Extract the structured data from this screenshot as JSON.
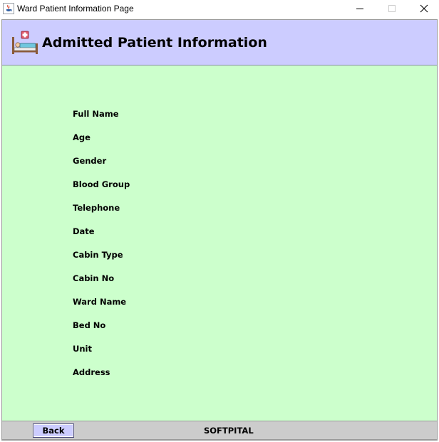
{
  "window": {
    "title": "Ward Patient Information Page",
    "icon": "java-cup-icon",
    "controls": {
      "minimize": "minimize-icon",
      "maximize": "maximize-icon",
      "close": "close-icon"
    }
  },
  "header": {
    "title": "Admitted Patient Information",
    "icon": "hospital-bed-icon",
    "background": "#ccccff"
  },
  "main": {
    "background": "#ccffcc",
    "fields": [
      {
        "label": "Full Name"
      },
      {
        "label": "Age"
      },
      {
        "label": "Gender"
      },
      {
        "label": "Blood Group"
      },
      {
        "label": "Telephone"
      },
      {
        "label": "Date"
      },
      {
        "label": "Cabin Type"
      },
      {
        "label": "Cabin No"
      },
      {
        "label": "Ward Name"
      },
      {
        "label": "Bed No"
      },
      {
        "label": "Unit"
      },
      {
        "label": "Address"
      }
    ]
  },
  "footer": {
    "back_label": "Back",
    "brand": "SOFTPITAL",
    "background": "#cccccc"
  }
}
